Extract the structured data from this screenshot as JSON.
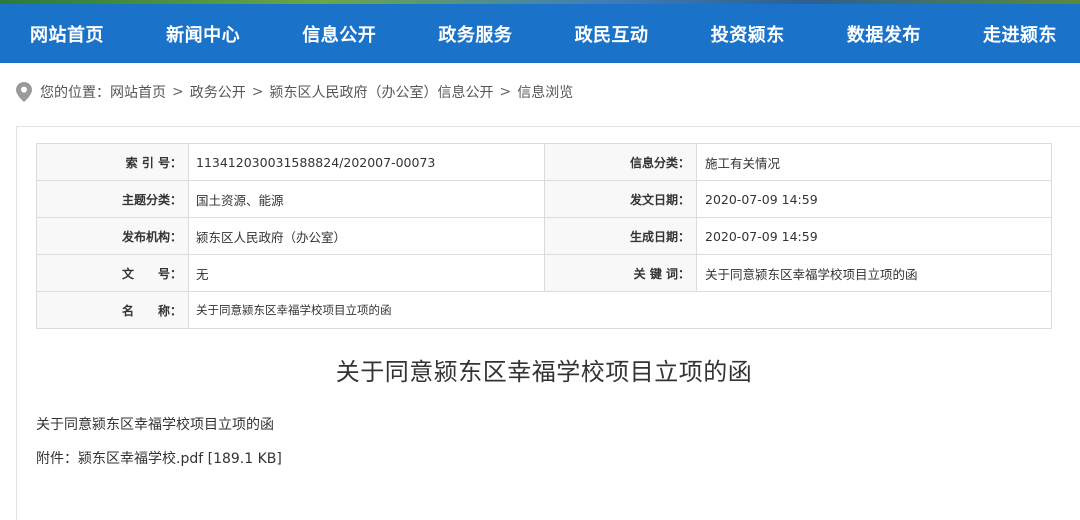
{
  "nav": {
    "items": [
      "网站首页",
      "新闻中心",
      "信息公开",
      "政务服务",
      "政民互动",
      "投资颍东",
      "数据发布",
      "走进颍东"
    ],
    "background": "#1a73c9"
  },
  "breadcrumb": {
    "prefix": "您的位置：",
    "items": [
      "网站首页",
      "政务公开",
      "颍东区人民政府（办公室）信息公开",
      "信息浏览"
    ],
    "separator": ">"
  },
  "meta": {
    "index_label": "索 引 号：",
    "index_value": "11341203003158882​4/202007-00073",
    "category_label": "信息分类：",
    "category_value": "施工有关情况",
    "topic_label": "主题分类：",
    "topic_value": "国土资源、能源",
    "issue_date_label": "发文日期：",
    "issue_date_value": "2020-07-09 14:59",
    "org_label": "发布机构：",
    "org_value": "颍东区人民政府（办公室）",
    "gen_date_label": "生成日期：",
    "gen_date_value": "2020-07-09 14:59",
    "docno_label": "文　　号：",
    "docno_value": "无",
    "keyword_label": "关 键 词：",
    "keyword_value": "关于同意颍东区幸福学校项目立项的函",
    "name_label": "名　　称：",
    "name_value": "关于同意颍东区幸福学校项目立项的函"
  },
  "article": {
    "title": "关于同意颍东区幸福学校项目立项的函",
    "paragraph": "关于同意颍东区幸福学校项目立项的函",
    "attachment_prefix": "附件：",
    "attachment_name": "颍东区幸福学校.pdf",
    "attachment_size": "[189.1 KB]"
  }
}
